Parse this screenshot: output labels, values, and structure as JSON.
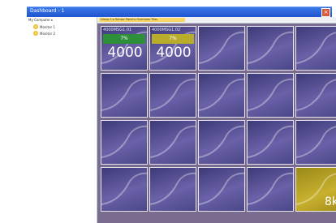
{
  "window": {
    "title": "Dashboard - 1"
  },
  "sidebar": {
    "root_label": "My Computer ▸",
    "items": [
      {
        "label": "Monitor 1",
        "icon": "gold-orb-icon"
      },
      {
        "label": "Monitor 2",
        "icon": "gold-orb-icon"
      }
    ]
  },
  "breadcrumb": "Group 1 ▸ Sensor Panel ▸ Overview Tiles",
  "tiles": [
    {
      "name": "4000MSG1.01",
      "percent": "7%",
      "value": "4000",
      "status_color": "#2e8f3b"
    },
    {
      "name": "4000MSG1.02",
      "percent": "7%",
      "value": "4000",
      "status_color": "#b8ad2b"
    },
    {
      "value_right": "8k",
      "status_color": "#c9b12e"
    }
  ]
}
